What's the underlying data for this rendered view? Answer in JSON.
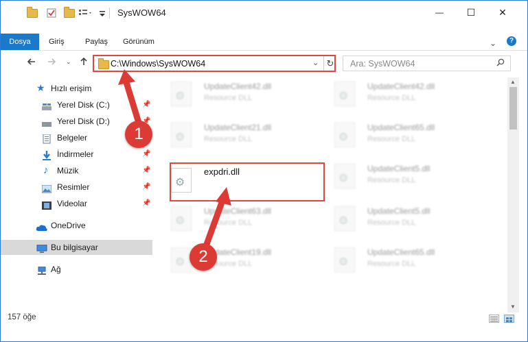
{
  "window": {
    "title": "SysWOW64",
    "controls": {
      "minimize": "—",
      "maximize": "☐",
      "close": "✕"
    }
  },
  "ribbon": {
    "tabs": [
      "Dosya",
      "Giriş",
      "Paylaş",
      "Görünüm"
    ],
    "help": "?"
  },
  "address": {
    "path": "C:\\Windows\\SysWOW64",
    "search_placeholder": "Ara: SysWOW64"
  },
  "sidebar": {
    "items": [
      {
        "label": "Hızlı erişim",
        "icon": "star-icon",
        "pinned": false
      },
      {
        "label": "Yerel Disk (C:)",
        "icon": "drive-icon",
        "pinned": true
      },
      {
        "label": "Yerel Disk (D:)",
        "icon": "drive-icon",
        "pinned": true
      },
      {
        "label": "Belgeler",
        "icon": "document-icon",
        "pinned": true
      },
      {
        "label": "İndirmeler",
        "icon": "download-icon",
        "pinned": true
      },
      {
        "label": "Müzik",
        "icon": "music-icon",
        "pinned": true
      },
      {
        "label": "Resimler",
        "icon": "picture-icon",
        "pinned": true
      },
      {
        "label": "Videolar",
        "icon": "video-icon",
        "pinned": true
      },
      {
        "label": "OneDrive",
        "icon": "cloud-icon",
        "pinned": false
      },
      {
        "label": "Bu bilgisayar",
        "icon": "computer-icon",
        "pinned": false
      },
      {
        "label": "Ağ",
        "icon": "network-icon",
        "pinned": false
      }
    ]
  },
  "files": {
    "left": [
      {
        "name": "UpdateClient42.dll",
        "type": "Resource DLL"
      },
      {
        "name": "UpdateClient21.dll",
        "type": "Resource DLL"
      },
      {
        "name": "expdri.dll",
        "type": ""
      },
      {
        "name": "UpdateClient63.dll",
        "type": "Resource DLL"
      },
      {
        "name": "UpdateClient19.dll",
        "type": "Resource DLL"
      }
    ],
    "right": [
      {
        "name": "UpdateClient42.dll",
        "type": "Resource DLL"
      },
      {
        "name": "UpdateClient65.dll",
        "type": "Resource DLL"
      },
      {
        "name": "UpdateClient5.dll",
        "type": "Resource DLL"
      },
      {
        "name": "UpdateClient5.dll",
        "type": "Resource DLL"
      },
      {
        "name": "UpdateClient65.dll",
        "type": "Resource DLL"
      }
    ]
  },
  "status": {
    "count": "157 öğe"
  },
  "annotations": {
    "step1": "1",
    "step2": "2",
    "color": "#dc3b35"
  }
}
